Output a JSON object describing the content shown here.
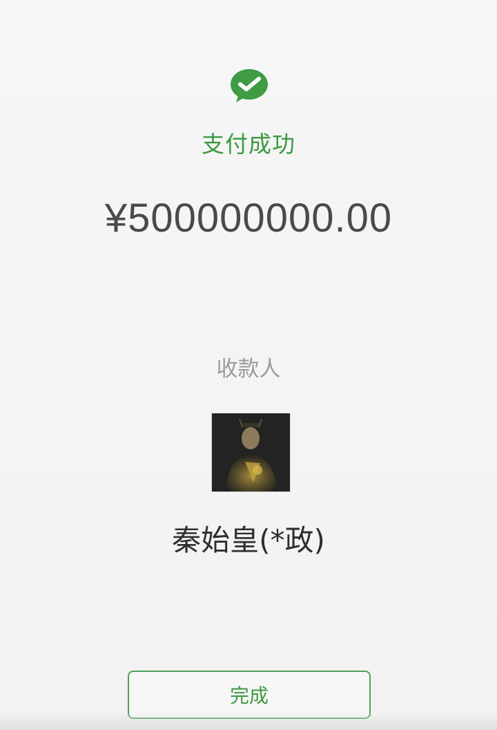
{
  "payment_result": {
    "status_text": "支付成功",
    "amount": "¥500000000.00",
    "payee_label": "收款人",
    "payee_name": "秦始皇(*政)",
    "done_label": "完成"
  },
  "icons": {
    "logo": "wechat-pay-check-icon",
    "avatar": "payee-portrait-avatar"
  },
  "colors": {
    "accent_green": "#3d9a42",
    "amount_text": "#4a4a4a",
    "label_gray": "#9a9a9a",
    "name_text": "#2e2e2e"
  }
}
